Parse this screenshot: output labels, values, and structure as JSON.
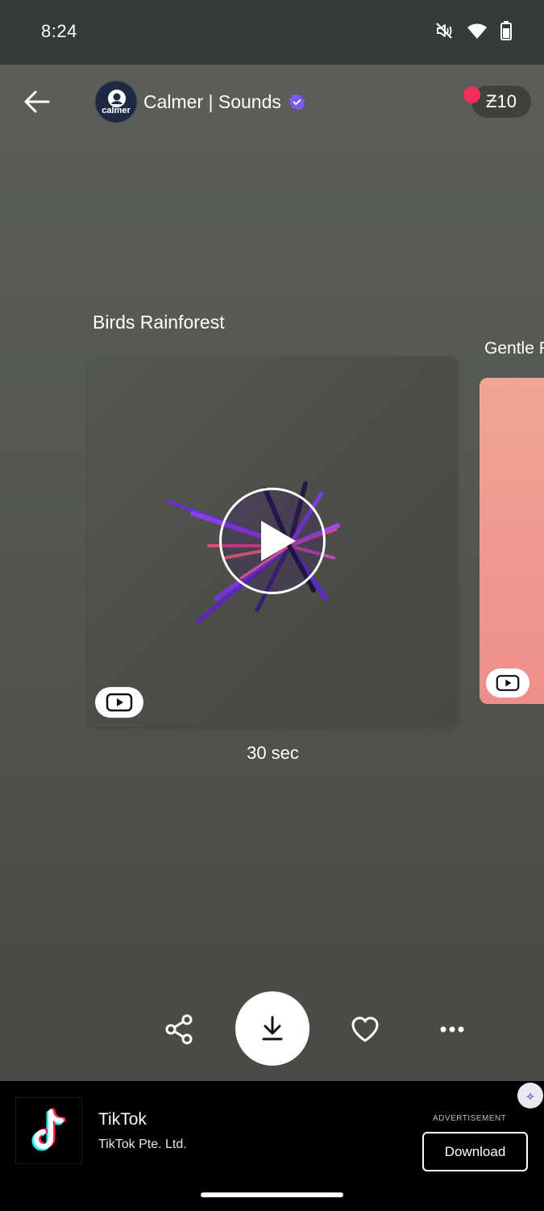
{
  "status_bar": {
    "time": "8:24",
    "icons": [
      "mute-icon",
      "wifi-icon",
      "battery-icon"
    ]
  },
  "header": {
    "channel_name": "Calmer | Sounds",
    "avatar_text": "calmer",
    "coins_label": "Ƶ10",
    "colors": {
      "notification_dot": "#f22e5b",
      "verified": "#7a5cf0"
    }
  },
  "carousel": {
    "current": {
      "title": "Birds Rainforest",
      "duration": "30 sec"
    },
    "next": {
      "title": "Gentle F",
      "color": "#ef9b8f"
    }
  },
  "actions": [
    "share-icon",
    "download-icon",
    "heart-icon",
    "more-icon"
  ],
  "ad": {
    "title": "TikTok",
    "subtitle": "TikTok Pte. Ltd.",
    "tag": "ADVERTISEMENT",
    "button": "Download",
    "choice_glyph": "⟡"
  }
}
